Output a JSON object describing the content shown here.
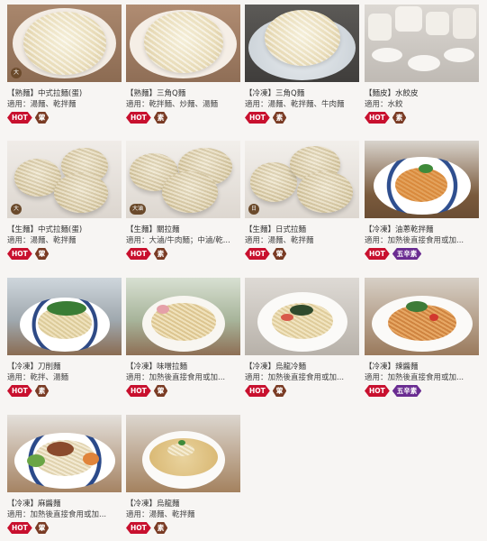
{
  "products": [
    {
      "title": "【熟麵】中式拉麵(蛋)",
      "usage": "適用：湯麵、乾拌麵",
      "hot": "HOT",
      "veg": "葷",
      "five": "",
      "thumb_badge": "大"
    },
    {
      "title": "【熟麵】三角Q麵",
      "usage": "適用：乾拌麵、炒麵、湯麵",
      "hot": "HOT",
      "veg": "素",
      "five": "",
      "thumb_badge": ""
    },
    {
      "title": "【冷凍】三角Q麵",
      "usage": "適用：湯麵、乾拌麵、牛肉麵",
      "hot": "HOT",
      "veg": "素",
      "five": "",
      "thumb_badge": ""
    },
    {
      "title": "【麵皮】水餃皮",
      "usage": "適用：水餃",
      "hot": "HOT",
      "veg": "素",
      "five": "",
      "thumb_badge": ""
    },
    {
      "title": "【生麵】中式拉麵(蛋)",
      "usage": "適用：湯麵、乾拌麵",
      "hot": "HOT",
      "veg": "葷",
      "five": "",
      "thumb_badge": "大"
    },
    {
      "title": "【生麵】關拉麵",
      "usage": "適用：大滷/牛肉麵；中滷/乾...",
      "hot": "HOT",
      "veg": "素",
      "five": "",
      "thumb_badge": "大滷"
    },
    {
      "title": "【生麵】日式拉麵",
      "usage": "適用：湯麵、乾拌麵",
      "hot": "HOT",
      "veg": "葷",
      "five": "",
      "thumb_badge": "日"
    },
    {
      "title": "【冷凍】油蔥乾拌麵",
      "usage": "適用：加熱後直接食用或加...",
      "hot": "HOT",
      "veg": "",
      "five": "五辛素",
      "thumb_badge": ""
    },
    {
      "title": "【冷凍】刀削麵",
      "usage": "適用：乾拌、湯麵",
      "hot": "HOT",
      "veg": "素",
      "five": "",
      "thumb_badge": ""
    },
    {
      "title": "【冷凍】味噌拉麵",
      "usage": "適用：加熱後直接食用或加...",
      "hot": "HOT",
      "veg": "葷",
      "five": "",
      "thumb_badge": ""
    },
    {
      "title": "【冷凍】烏龍冷麵",
      "usage": "適用：加熱後直接食用或加...",
      "hot": "HOT",
      "veg": "葷",
      "five": "",
      "thumb_badge": ""
    },
    {
      "title": "【冷凍】辣醬麵",
      "usage": "適用：加熱後直接食用或加...",
      "hot": "HOT",
      "veg": "",
      "five": "五辛素",
      "thumb_badge": ""
    },
    {
      "title": "【冷凍】麻醬麵",
      "usage": "適用：加熱後直接食用或加...",
      "hot": "HOT",
      "veg": "葷",
      "five": "",
      "thumb_badge": ""
    },
    {
      "title": "【冷凍】烏龍麵",
      "usage": "適用：湯麵、乾拌麵",
      "hot": "HOT",
      "veg": "素",
      "five": "",
      "thumb_badge": ""
    }
  ]
}
